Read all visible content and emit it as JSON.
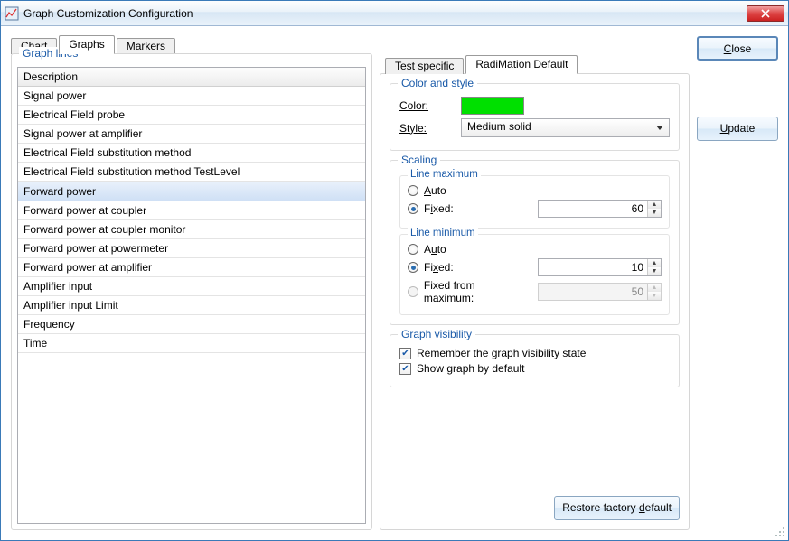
{
  "window": {
    "title": "Graph Customization Configuration"
  },
  "tabs": {
    "chart": "Chart",
    "graphs": "Graphs",
    "markers": "Markers"
  },
  "buttons": {
    "close": "Close",
    "update": "Update",
    "restore": "Restore factory default"
  },
  "graph_lines": {
    "group_label": "Graph lines",
    "header": "Description",
    "items": [
      "Signal power",
      "Electrical Field probe",
      "Signal power at amplifier",
      "Electrical Field substitution method",
      "Electrical Field substitution method TestLevel",
      "Forward power",
      "Forward power at coupler",
      "Forward power at coupler monitor",
      "Forward power at powermeter",
      "Forward power at amplifier",
      "Amplifier input",
      "Amplifier input Limit",
      "Frequency",
      "Time"
    ],
    "selected_index": 5
  },
  "inner_tabs": {
    "test_specific": "Test specific",
    "radimation_default": "RadiMation Default"
  },
  "color_style": {
    "group_label": "Color and style",
    "color_label": "Color:",
    "color_value": "#00e000",
    "style_label": "Style:",
    "style_value": "Medium solid"
  },
  "scaling": {
    "group_label": "Scaling",
    "max": {
      "label": "Line maximum",
      "auto": "Auto",
      "fixed": "Fixed:",
      "value": "60",
      "selected": "fixed"
    },
    "min": {
      "label": "Line minimum",
      "auto": "Auto",
      "fixed": "Fixed:",
      "fixed_from_max": "Fixed from maximum:",
      "value": "10",
      "from_max_value": "50",
      "selected": "fixed"
    }
  },
  "visibility": {
    "group_label": "Graph visibility",
    "remember": "Remember the graph visibility state",
    "show_default": "Show graph by default"
  }
}
